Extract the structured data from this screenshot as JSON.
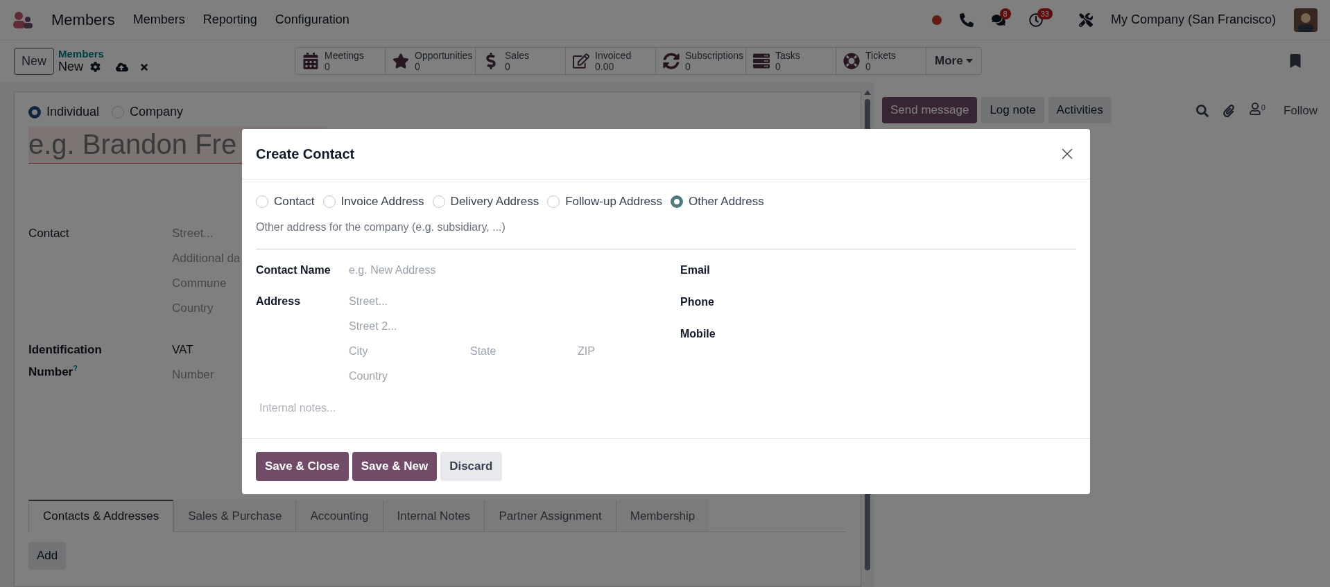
{
  "navbar": {
    "app": "Members",
    "menus": [
      "Members",
      "Reporting",
      "Configuration"
    ],
    "messages_badge": "8",
    "activities_badge": "33",
    "company": "My Company (San Francisco)"
  },
  "control_panel": {
    "new_button": "New",
    "breadcrumb": "Members",
    "record": "New",
    "more": "More",
    "smart_buttons": [
      {
        "kind": "calendar",
        "label": "Meetings",
        "value": "0"
      },
      {
        "kind": "star",
        "label": "Opportunities",
        "value": "0"
      },
      {
        "kind": "dollar",
        "label": "Sales",
        "value": "0"
      },
      {
        "kind": "edit",
        "label": "Invoiced",
        "value": "0.00"
      },
      {
        "kind": "sync",
        "label": "Subscriptions",
        "value": "0"
      },
      {
        "kind": "tasks",
        "label": "Tasks",
        "value": "0"
      },
      {
        "kind": "lifering",
        "label": "Tickets",
        "value": "0"
      }
    ]
  },
  "form": {
    "company_types": [
      {
        "label": "Individual",
        "selected": true
      },
      {
        "label": "Company",
        "selected": false
      }
    ],
    "name_placeholder": "e.g. Brandon Fre",
    "fields": [
      {
        "label": "Contact",
        "lines": [
          {
            "kind": "placeholder",
            "text": "Street..."
          },
          {
            "kind": "placeholder",
            "text": "Additional da"
          },
          {
            "kind": "placeholder",
            "text": "Commune"
          },
          {
            "kind": "placeholder",
            "text": "Country"
          }
        ]
      },
      {
        "label": "Identification Number$^{?}$",
        "lines": [
          {
            "kind": "value",
            "text": "VAT"
          },
          {
            "kind": "placeholder",
            "text": "Number"
          }
        ]
      }
    ],
    "tabs": [
      {
        "label": "Contacts & Addresses",
        "selected": true
      },
      {
        "label": "Sales & Purchase",
        "selected": false
      },
      {
        "label": "Accounting",
        "selected": false
      },
      {
        "label": "Internal Notes",
        "selected": false
      },
      {
        "label": "Partner Assignment",
        "selected": false
      },
      {
        "label": "Membership",
        "selected": false
      }
    ],
    "add_button": "Add"
  },
  "chatter": {
    "buttons": [
      {
        "label": "Send message",
        "selected": true
      },
      {
        "label": "Log note",
        "selected": false
      },
      {
        "label": "Activities",
        "selected": false
      }
    ],
    "followers_count": "0",
    "follow": "Follow"
  },
  "dialog": {
    "title": "Create Contact",
    "types": [
      {
        "label": "Contact",
        "selected": false
      },
      {
        "label": "Invoice Address",
        "selected": false
      },
      {
        "label": "Delivery Address",
        "selected": false
      },
      {
        "label": "Follow-up Address",
        "selected": false
      },
      {
        "label": "Other Address",
        "selected": true
      }
    ],
    "description": "Other address for the company (e.g. subsidiary, ...)",
    "contact_name_label": "Contact Name",
    "contact_name_placeholder": "e.g. New Address",
    "address_label": "Address",
    "street_placeholder": "Street...",
    "street2_placeholder": "Street 2...",
    "city_placeholder": "City",
    "state_placeholder": "State",
    "zip_placeholder": "ZIP",
    "country_placeholder": "Country",
    "right_labels": [
      "Email",
      "Phone",
      "Mobile"
    ],
    "notes_placeholder": "Internal notes...",
    "buttons": [
      {
        "kind": "primary",
        "label": "Save & Close"
      },
      {
        "kind": "primary",
        "label": "Save & New"
      },
      {
        "kind": "secondary",
        "label": "Discard"
      }
    ]
  }
}
